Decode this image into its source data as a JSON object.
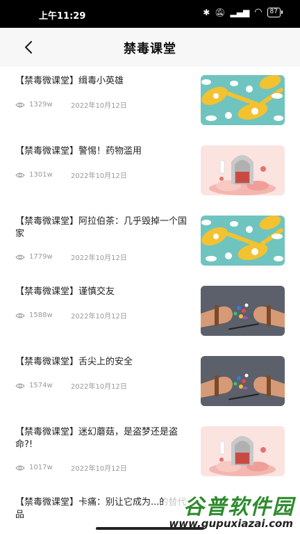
{
  "status_bar": {
    "time": "上午11:29",
    "battery": "87"
  },
  "header": {
    "title": "禁毒课堂"
  },
  "articles": [
    {
      "title": "【禁毒微课堂】缉毒小英雄",
      "views": "1329w",
      "date": "2022年10月12日",
      "image": "pills-spoons"
    },
    {
      "title": "【禁毒微课堂】警惕！药物滥用",
      "views": "1301w",
      "date": "2022年10月12日",
      "image": "pink-capsule"
    },
    {
      "title": "【禁毒微课堂】阿拉伯茶：几乎毁掉一个国家",
      "views": "1779w",
      "date": "2022年10月12日",
      "image": "pills-spoons"
    },
    {
      "title": "【禁毒微课堂】谨慎交友",
      "views": "1588w",
      "date": "2022年10月12日",
      "image": "handcuffed-hands"
    },
    {
      "title": "【禁毒微课堂】舌尖上的安全",
      "views": "1574w",
      "date": "2022年10月12日",
      "image": "handcuffed-hands"
    },
    {
      "title": "【禁毒微课堂】迷幻蘑菇，是盗梦还是盗命?!",
      "views": "1017w",
      "date": "2022年10月12日",
      "image": "pink-capsule"
    },
    {
      "title": "【禁毒微课堂】卡痛：别让它成为...的替代品",
      "views": "",
      "date": "",
      "image": ""
    }
  ],
  "watermark": {
    "title": "谷普软件园",
    "url": "www.gupuxiazai.com"
  }
}
